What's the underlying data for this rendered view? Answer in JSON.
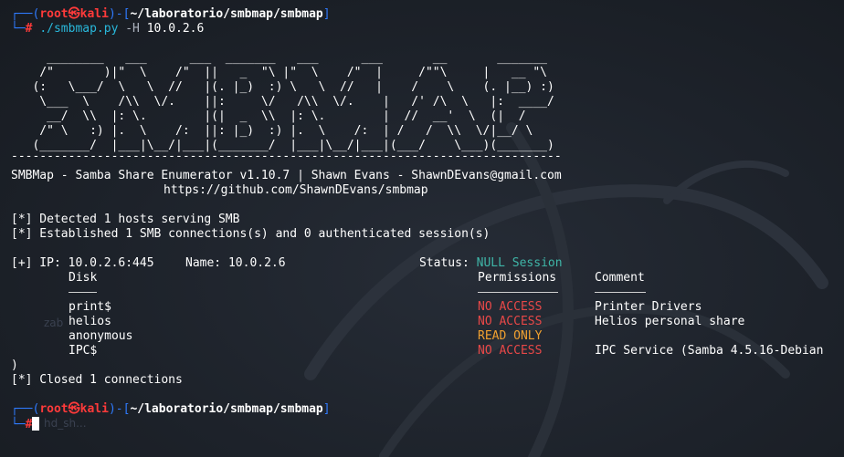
{
  "prompt": {
    "user": "root",
    "skull": "㉿",
    "host": "kali",
    "path": "~/laboratorio/smbmap/smbmap",
    "symbol": "#"
  },
  "command": {
    "program": "./smbmap.py",
    "flag": "-H",
    "arg": "10.0.2.6"
  },
  "banner": [
    "     ________   ___      ___  _______   ___      ___       __       _______",
    "    /\"       )|\"  \\    /\"  ||   _  \"\\ |\"  \\    /\"  |     /\"\"\\     |   __ \"\\",
    "   (:   \\___/  \\   \\  //   |(. |_)  :) \\   \\  //   |    /    \\    (. |__) :)",
    "    \\___  \\    /\\\\  \\/.    ||:     \\/   /\\\\  \\/.    |   /' /\\  \\   |:  ____/",
    "     __/  \\\\  |: \\.        |(|  _  \\\\  |: \\.        |  //  __'  \\  (|  /",
    "    /\" \\   :) |.  \\    /:  ||: |_)  :) |.  \\    /:  | /   /  \\\\  \\/|__/ \\",
    "   (_______/  |___|\\__/|___|(_______/  |___|\\__/|___|(___/    \\___)(_______)"
  ],
  "banner_rule": "-----------------------------------------------------------------------------",
  "info_line1": "SMBMap - Samba Share Enumerator v1.10.7 | Shawn Evans - ShawnDEvans@gmail.com",
  "info_line2": "https://github.com/ShawnDEvans/smbmap",
  "status_lines": [
    "[*] Detected 1 hosts serving SMB",
    "[*] Established 1 SMB connections(s) and 0 authenticated session(s)"
  ],
  "host_line": {
    "prefix": "[+] IP: 10.0.2.6:445",
    "name": "Name: 10.0.2.6",
    "status_label": "Status: ",
    "status_value": "NULL Session"
  },
  "table": {
    "headers": {
      "disk": "Disk",
      "permissions": "Permissions",
      "comment": "Comment"
    },
    "rows": [
      {
        "disk": "print$",
        "permissions": "NO ACCESS",
        "perm_color": "#e84848",
        "comment": "Printer Drivers"
      },
      {
        "disk": "helios",
        "permissions": "NO ACCESS",
        "perm_color": "#e84848",
        "comment": "Helios personal share"
      },
      {
        "disk": "anonymous",
        "permissions": "READ ONLY",
        "perm_color": "#f0a030",
        "comment": ""
      },
      {
        "disk": "IPC$",
        "permissions": "NO ACCESS",
        "perm_color": "#e84848",
        "comment": "IPC Service (Samba 4.5.16-Debian"
      }
    ]
  },
  "close_paren": ")",
  "closed_line": "[*] Closed 1 connections",
  "ghost_text": {
    "a": "zab",
    "b": "hd_sh..."
  }
}
